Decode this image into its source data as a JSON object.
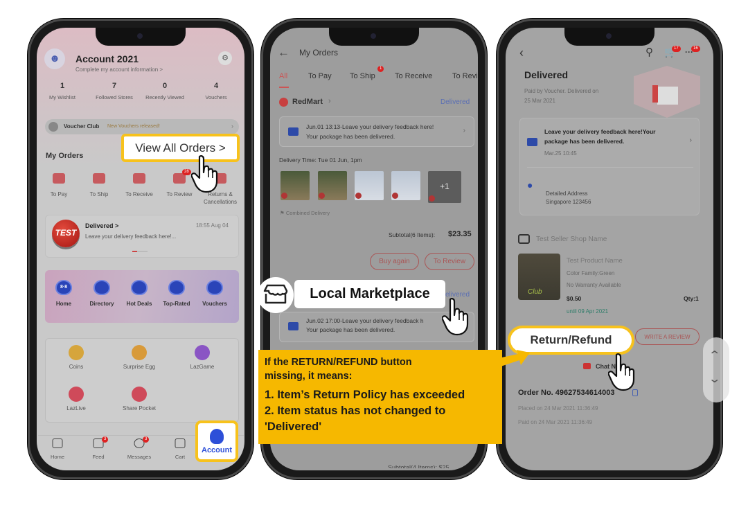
{
  "colors": {
    "highlight": "#f7c21c",
    "callout_bg": "#f6b800",
    "accent_red": "#d0413e",
    "link_blue": "#5b6fb3",
    "account_blue": "#2d4fd8"
  },
  "phone1": {
    "title": "Account 2021",
    "subtitle": "Complete my account information >",
    "stats": [
      {
        "value": "1",
        "label": "My Wishlist"
      },
      {
        "value": "7",
        "label": "Followed Stores"
      },
      {
        "value": "0",
        "label": "Recently Viewed"
      },
      {
        "value": "4",
        "label": "Vouchers"
      }
    ],
    "voucher_club": "Voucher Club",
    "voucher_msg": "New Vouchers released!",
    "view_all": "View All Orders >",
    "my_orders": "My Orders",
    "order_tabs": [
      {
        "label": "To Pay"
      },
      {
        "label": "To Ship"
      },
      {
        "label": "To Receive"
      },
      {
        "label": "To Review",
        "badge": "28"
      },
      {
        "label": "Returns &",
        "label2": "Cancellations"
      }
    ],
    "delivered_card": {
      "logo": "TEST",
      "title": "Delivered >",
      "time": "18:55 Aug 04",
      "text": "Leave your delivery feedback here!..."
    },
    "promo": [
      "Home",
      "Directory",
      "Hot Deals",
      "Top-Rated",
      "Vouchers"
    ],
    "promo_home_glyph": "8·8",
    "services": [
      "Coins",
      "Surprise Egg",
      "LazGame",
      "LazLive",
      "Share Pocket"
    ],
    "nav": [
      {
        "label": "Home"
      },
      {
        "label": "Feed",
        "badge": "3"
      },
      {
        "label": "Messages",
        "badge": "3"
      },
      {
        "label": "Cart"
      },
      {
        "label": "Account"
      }
    ]
  },
  "phone2": {
    "title": "My Orders",
    "tabs": [
      {
        "label": "All",
        "active": true
      },
      {
        "label": "To Pay"
      },
      {
        "label": "To Ship",
        "badge": "1"
      },
      {
        "label": "To Receive"
      },
      {
        "label": "To Revi"
      }
    ],
    "store": "RedMart",
    "store_status": "Delivered",
    "feedback1": "Jun.01 13:13-Leave your delivery feedback here!",
    "feedback1b": "Your package has been delivered.",
    "delivery_time": "Delivery Time: Tue 01 Jun, 1pm",
    "more_items": "+1",
    "combined": "Combined Delivery",
    "subtotal_label": "Subtotal(6 Items):",
    "subtotal": "$23.35",
    "buy_again": "Buy again",
    "to_review": "To Review",
    "local_marketplace": "Local Marketplace",
    "status2": "elivered",
    "feedback2": "Jun.02 17:00-Leave your delivery feedback h",
    "feedback2b": "Your package has been delivered.",
    "subtotal2": "Subtotal(4 Items):  $25",
    "callout": {
      "line1": "If the RETURN/REFUND button",
      "line2": "missing, it means:",
      "point1": "1. Item’s Return Policy has exceeded",
      "point2": "2. Item status has not changed to",
      "point2b": "'Delivered'"
    }
  },
  "phone3": {
    "cart_badge": "17",
    "more_badge": "16",
    "status": "Delivered",
    "paid_line1": "Paid by Voucher. Delivered on",
    "paid_line2": "25 Mar 2021",
    "feedback": "Leave your delivery feedback here!Your",
    "feedback_b": "package has been delivered.",
    "feedback_time": "Mar.25 10:45",
    "address1": "Detailed Address",
    "address2": "Singapore 123456",
    "shop": "Test Seller Shop Name",
    "product": "Test Product Name",
    "color": "Color Family:Green",
    "warranty": "No Warranty Available",
    "price": "$0.50",
    "qty": "Qty:1",
    "until": "until  09 Apr 2021",
    "return_refund": "Return/Refund",
    "write_review": "WRITE A REVIEW",
    "chat": "Chat N",
    "order_no": "Order No. 49627534614003",
    "placed": "Placed on 24 Mar 2021  11:36:49",
    "paid": "Paid on 24 Mar 2021  11:36:49"
  }
}
